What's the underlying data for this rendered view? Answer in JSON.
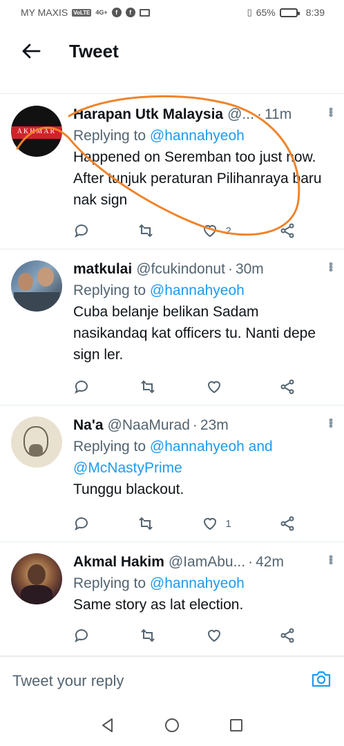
{
  "status_bar": {
    "carrier": "MY MAXIS",
    "volte": "VoLTE",
    "network": "4G+",
    "battery_percent": "65%",
    "battery_level": 0.65,
    "time": "8:39"
  },
  "header": {
    "title": "Tweet"
  },
  "tweets": [
    {
      "name": "Harapan Utk Malaysia",
      "handle": "@...",
      "time": "11m",
      "reply_label": "Replying to",
      "mentions": "@hannahyeoh",
      "text": "Happened on Seremban too just now. After tunjuk peraturan Pilihanraya baru nak sign",
      "likes": "2",
      "avatar_text": "AKHMAR"
    },
    {
      "name": "matkulai",
      "handle": "@fcukindonut",
      "time": "30m",
      "reply_label": "Replying to",
      "mentions": "@hannahyeoh",
      "text": "Cuba belanje belikan Sadam nasikandaq kat officers tu. Nanti depe sign ler.",
      "likes": ""
    },
    {
      "name": "Na'a",
      "handle": "@NaaMurad",
      "time": "23m",
      "reply_label": "Replying to",
      "mentions": "@hannahyeoh and @McNastyPrime",
      "text": "Tunggu blackout.",
      "likes": "1"
    },
    {
      "name": "Akmal Hakim",
      "handle": "@IamAbu...",
      "time": "42m",
      "reply_label": "Replying to",
      "mentions": "@hannahyeoh",
      "text": "Same story as lat election.",
      "likes": ""
    }
  ],
  "reply_bar": {
    "placeholder": "Tweet your reply"
  },
  "icons": {
    "back": "arrow-left-icon",
    "reply": "comment-icon",
    "retweet": "retweet-icon",
    "like": "heart-icon",
    "share": "share-icon",
    "camera": "camera-icon",
    "nav_back": "triangle-back-icon",
    "nav_home": "circle-home-icon",
    "nav_recent": "square-recent-icon"
  },
  "colors": {
    "link": "#1d9bf0",
    "annotation": "#f0832a"
  }
}
